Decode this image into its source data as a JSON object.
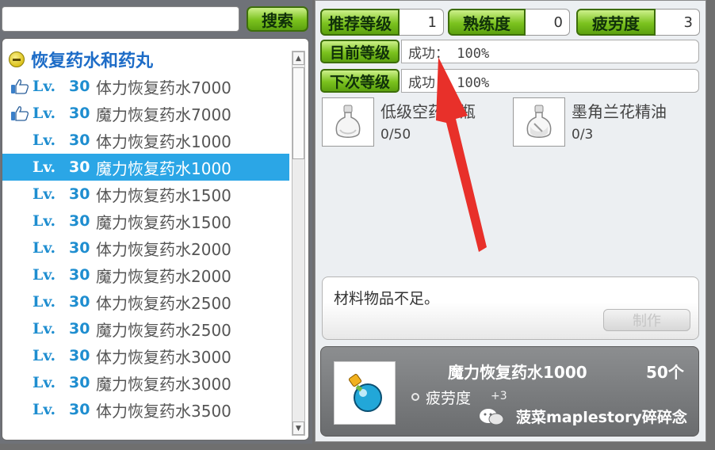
{
  "search": {
    "value": "",
    "button_label": "搜索"
  },
  "category": {
    "label": "恢复药水和药丸"
  },
  "recipes": [
    {
      "lv": "Lv.",
      "level": "30",
      "name": "体力恢复药水7000",
      "thumb": true,
      "selected": false
    },
    {
      "lv": "Lv.",
      "level": "30",
      "name": "魔力恢复药水7000",
      "thumb": true,
      "selected": false
    },
    {
      "lv": "Lv.",
      "level": "30",
      "name": "体力恢复药水1000",
      "thumb": false,
      "selected": false
    },
    {
      "lv": "Lv.",
      "level": "30",
      "name": "魔力恢复药水1000",
      "thumb": false,
      "selected": true
    },
    {
      "lv": "Lv.",
      "level": "30",
      "name": "体力恢复药水1500",
      "thumb": false,
      "selected": false
    },
    {
      "lv": "Lv.",
      "level": "30",
      "name": "魔力恢复药水1500",
      "thumb": false,
      "selected": false
    },
    {
      "lv": "Lv.",
      "level": "30",
      "name": "体力恢复药水2000",
      "thumb": false,
      "selected": false
    },
    {
      "lv": "Lv.",
      "level": "30",
      "name": "魔力恢复药水2000",
      "thumb": false,
      "selected": false
    },
    {
      "lv": "Lv.",
      "level": "30",
      "name": "体力恢复药水2500",
      "thumb": false,
      "selected": false
    },
    {
      "lv": "Lv.",
      "level": "30",
      "name": "魔力恢复药水2500",
      "thumb": false,
      "selected": false
    },
    {
      "lv": "Lv.",
      "level": "30",
      "name": "体力恢复药水3000",
      "thumb": false,
      "selected": false
    },
    {
      "lv": "Lv.",
      "level": "30",
      "name": "魔力恢复药水3000",
      "thumb": false,
      "selected": false
    },
    {
      "lv": "Lv.",
      "level": "30",
      "name": "体力恢复药水3500",
      "thumb": false,
      "selected": false
    }
  ],
  "stats": {
    "recommended_level": {
      "label": "推荐等级",
      "value": "1"
    },
    "proficiency": {
      "label": "熟练度",
      "value": "0"
    },
    "fatigue": {
      "label": "疲劳度",
      "value": "3"
    }
  },
  "current_level": {
    "label": "目前等级",
    "text": "成功： 100%"
  },
  "next_level": {
    "label": "下次等级",
    "text": "成功： 100%"
  },
  "materials": [
    {
      "name": "低级空药水瓶",
      "count": "0/50",
      "icon": "empty-flask-icon"
    },
    {
      "name": "墨角兰花精油",
      "count": "0/3",
      "icon": "oil-flask-icon"
    }
  ],
  "message": {
    "text": "材料物品不足。",
    "craft_button": "制作"
  },
  "result": {
    "name": "魔力恢复药水1000",
    "quantity": "50个",
    "fatigue_label": "疲劳度",
    "fatigue_value": "+3",
    "icon": "mana-potion-icon"
  },
  "watermark": {
    "text": "菠菜maplestory碎碎念"
  },
  "colors": {
    "accent_blue": "#1f8ed0",
    "selected_row": "#2ba6e6",
    "green_button": "#7bc21e",
    "arrow_red": "#e8302a"
  }
}
